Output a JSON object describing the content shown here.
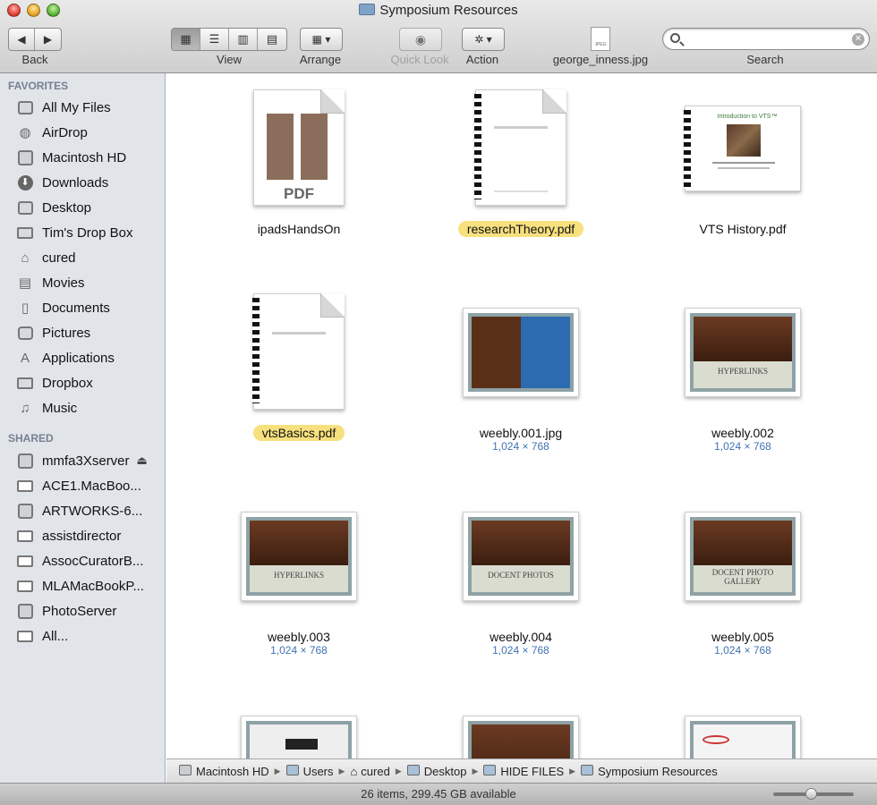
{
  "window": {
    "title": "Symposium Resources"
  },
  "toolbar": {
    "back_label": "Back",
    "view_label": "View",
    "arrange_label": "Arrange",
    "quicklook_label": "Quick Look",
    "action_label": "Action",
    "file_label": "george_inness.jpg",
    "search_label": "Search",
    "search_placeholder": "",
    "file_icon_text": "JPEG"
  },
  "sidebar": {
    "favorites_heading": "FAVORITES",
    "shared_heading": "SHARED",
    "favorites": [
      {
        "label": "All My Files",
        "icon": "all-files-icon"
      },
      {
        "label": "AirDrop",
        "icon": "airdrop-icon"
      },
      {
        "label": "Macintosh HD",
        "icon": "hard-disk-icon"
      },
      {
        "label": "Downloads",
        "icon": "downloads-icon"
      },
      {
        "label": "Desktop",
        "icon": "desktop-icon"
      },
      {
        "label": "Tim's Drop Box",
        "icon": "folder-icon"
      },
      {
        "label": "cured",
        "icon": "home-icon"
      },
      {
        "label": "Movies",
        "icon": "movies-icon"
      },
      {
        "label": "Documents",
        "icon": "documents-icon"
      },
      {
        "label": "Pictures",
        "icon": "camera-icon"
      },
      {
        "label": "Applications",
        "icon": "applications-icon"
      },
      {
        "label": "Dropbox",
        "icon": "folder-icon"
      },
      {
        "label": "Music",
        "icon": "music-icon"
      }
    ],
    "shared": [
      {
        "label": "mmfa3Xserver",
        "icon": "server-icon"
      },
      {
        "label": "ACE1.MacBoo...",
        "icon": "display-icon"
      },
      {
        "label": "ARTWORKS-6...",
        "icon": "server-icon"
      },
      {
        "label": "assistdirector",
        "icon": "display-icon"
      },
      {
        "label": "AssocCuratorB...",
        "icon": "display-icon"
      },
      {
        "label": "MLAMacBookP...",
        "icon": "display-icon"
      },
      {
        "label": "PhotoServer",
        "icon": "server-icon"
      },
      {
        "label": "All...",
        "icon": "network-icon"
      }
    ]
  },
  "files": [
    {
      "name": "ipadsHandsOn",
      "dims": "",
      "selected": false,
      "kind": "pdf",
      "thumb_text": "PDF"
    },
    {
      "name": "researchTheory.pdf",
      "dims": "",
      "selected": true,
      "kind": "doc"
    },
    {
      "name": "VTS History.pdf",
      "dims": "",
      "selected": false,
      "kind": "slide",
      "thumb_text": "Introduction to VTS™"
    },
    {
      "name": "vtsBasics.pdf",
      "dims": "",
      "selected": true,
      "kind": "doc"
    },
    {
      "name": "weebly.001.jpg",
      "dims": "1,024 × 768",
      "selected": false,
      "kind": "img"
    },
    {
      "name": "weebly.002",
      "dims": "1,024 × 768",
      "selected": false,
      "kind": "img",
      "thumb_text": "HYPERLINKS"
    },
    {
      "name": "weebly.003",
      "dims": "1,024 × 768",
      "selected": false,
      "kind": "img",
      "thumb_text": "HYPERLINKS"
    },
    {
      "name": "weebly.004",
      "dims": "1,024 × 768",
      "selected": false,
      "kind": "img",
      "thumb_text": "DOCENT PHOTOS"
    },
    {
      "name": "weebly.005",
      "dims": "1,024 × 768",
      "selected": false,
      "kind": "img",
      "thumb_text": "DOCENT PHOTO GALLERY"
    }
  ],
  "pathbar": [
    "Macintosh HD",
    "Users",
    "cured",
    "Desktop",
    "HIDE FILES",
    "Symposium Resources"
  ],
  "status": {
    "text": "26 items, 299.45 GB available"
  },
  "colors": {
    "selection": "#f7e07e",
    "sidebar_bg": "#e1e5ea",
    "dims_text": "#3f73b1"
  }
}
